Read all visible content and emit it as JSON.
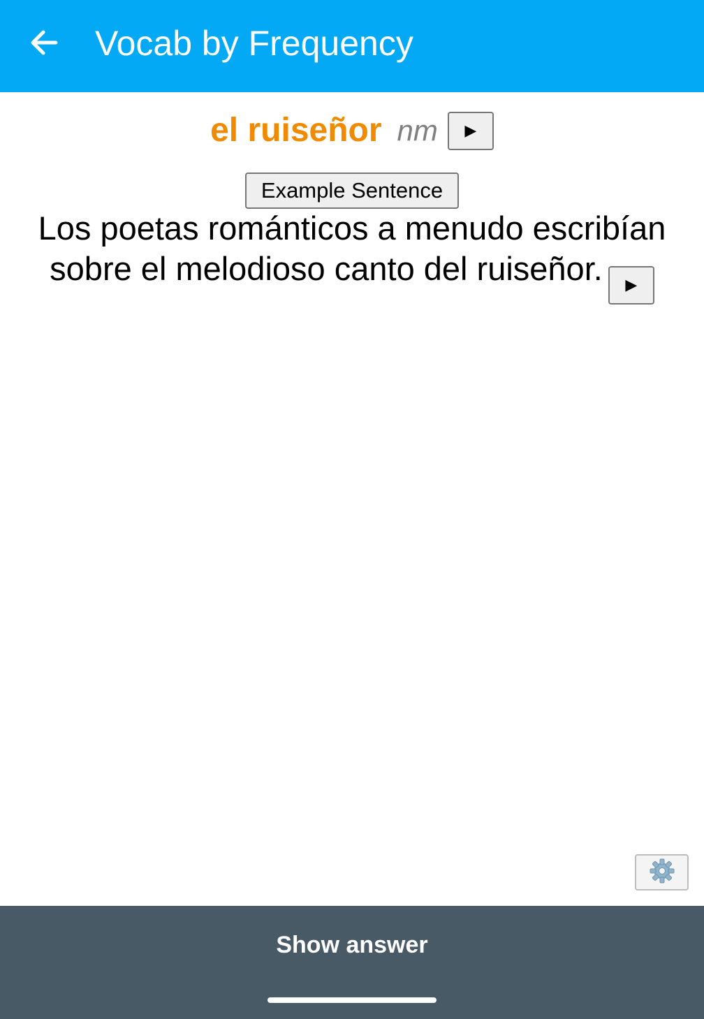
{
  "appbar": {
    "title": "Vocab by Frequency",
    "back_icon": "arrow-left-icon",
    "background": "#03a9f4"
  },
  "card": {
    "word": "el ruiseñor",
    "part_of_speech": "nm",
    "word_color": "#f08a00",
    "play_word_label": "▶",
    "example_button_label": "Example Sentence",
    "sentence_text": "Los poetas románticos a menudo escribían sobre el melodioso canto del ruiseñor.",
    "play_sentence_label": "▶"
  },
  "settings": {
    "icon": "gear-icon",
    "glyph": "⚙️"
  },
  "bottom": {
    "show_answer_label": "Show answer",
    "background": "#475a66"
  }
}
